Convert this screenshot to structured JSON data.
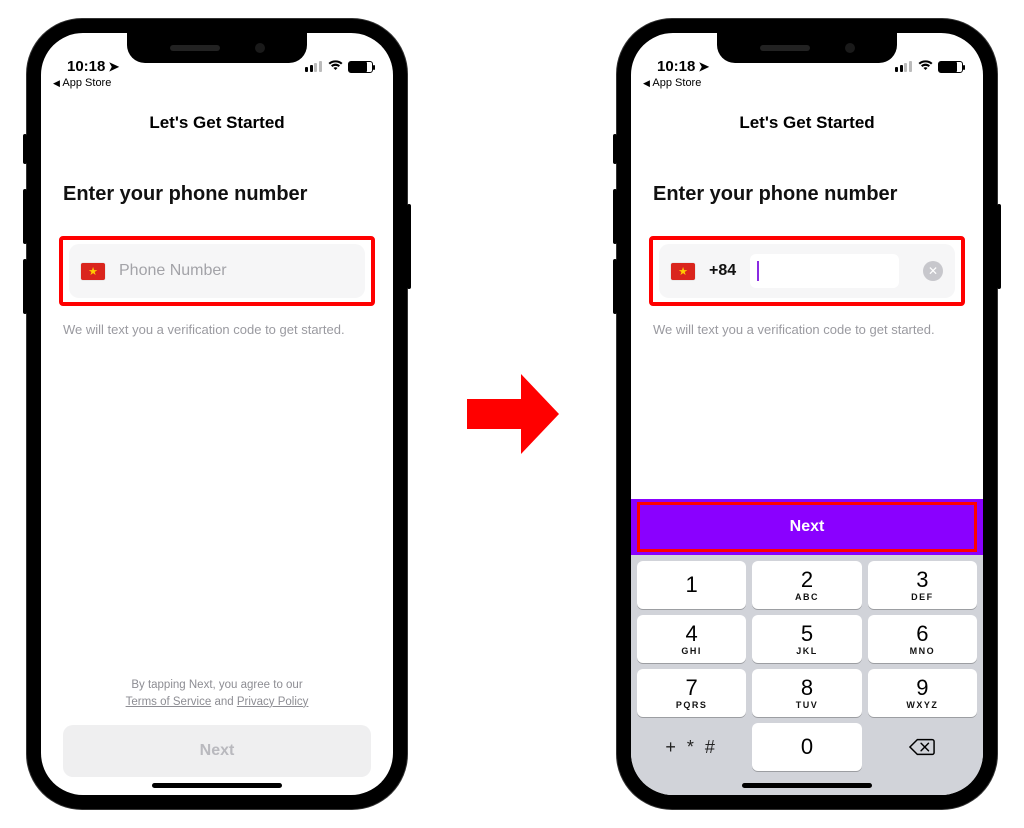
{
  "status": {
    "time": "10:18",
    "back_to_app": "App Store"
  },
  "header": {
    "title": "Let's Get Started"
  },
  "form": {
    "heading": "Enter your phone number",
    "flag_icon": "vietnam-flag",
    "placeholder": "Phone Number",
    "dial_code": "+84",
    "hint": "We will text you a verification code to get started."
  },
  "legal": {
    "prefix": "By tapping Next, you agree to our",
    "tos": "Terms of Service",
    "and": "and",
    "privacy": "Privacy Policy"
  },
  "buttons": {
    "next": "Next"
  },
  "keypad": {
    "keys": [
      {
        "num": "1",
        "letters": ""
      },
      {
        "num": "2",
        "letters": "ABC"
      },
      {
        "num": "3",
        "letters": "DEF"
      },
      {
        "num": "4",
        "letters": "GHI"
      },
      {
        "num": "5",
        "letters": "JKL"
      },
      {
        "num": "6",
        "letters": "MNO"
      },
      {
        "num": "7",
        "letters": "PQRS"
      },
      {
        "num": "8",
        "letters": "TUV"
      },
      {
        "num": "9",
        "letters": "WXYZ"
      }
    ],
    "symbols": "+ * #",
    "zero": "0"
  }
}
